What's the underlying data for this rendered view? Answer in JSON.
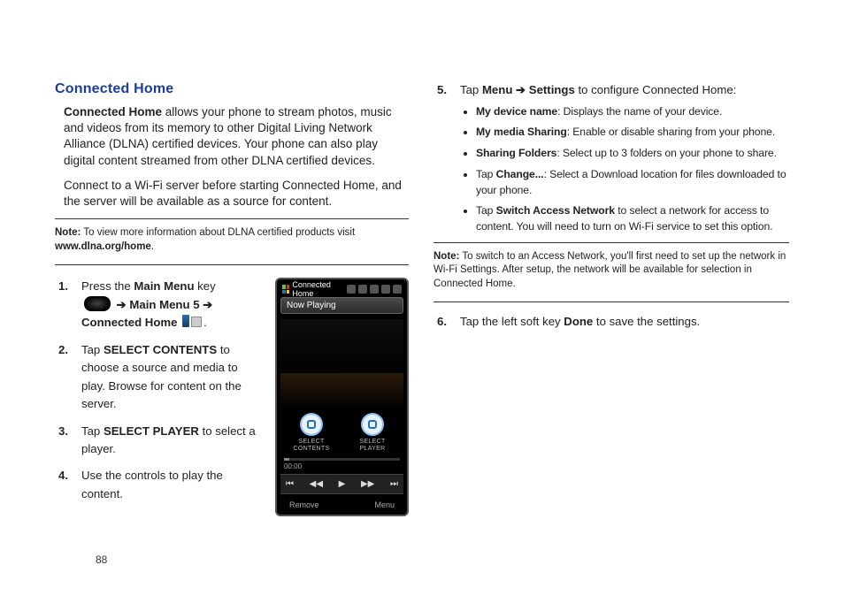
{
  "page_number": "88",
  "left": {
    "title": "Connected Home",
    "intro1_pre": "Connected Home",
    "intro1_post": " allows your phone to stream photos, music and videos from its memory to other Digital Living Network Alliance (DLNA) certified devices.  Your phone can also play digital content streamed from other DLNA certified devices.",
    "intro2": "Connect to a Wi-Fi server before starting Connected Home, and the server will be available as a source for content.",
    "note_label": "Note:",
    "note_body": " To view more information about DLNA certified products visit ",
    "note_link": "www.dlna.org/home",
    "note_end": ".",
    "step1_a": "Press the ",
    "step1_b": "Main Menu",
    "step1_c": " key",
    "step1_d": "Main Menu 5",
    "step1_e": "Connected Home",
    "step1_f": ".",
    "arrow": "➔",
    "step2_a": "Tap ",
    "step2_b": "SELECT CONTENTS",
    "step2_c": " to choose a source and media to play. Browse for content on the server.",
    "step3_a": "Tap ",
    "step3_b": "SELECT PLAYER",
    "step3_c": " to select a player.",
    "step4": "Use the controls to play the content."
  },
  "phone": {
    "title": "Connected Home",
    "now_playing": "Now Playing",
    "select_contents_l1": "SELECT",
    "select_contents_l2": "CONTENTS",
    "select_player_l1": "SELECT",
    "select_player_l2": "PLAYER",
    "time_left": "00:00",
    "time_right": "",
    "soft_left": "Remove",
    "soft_right": "Menu"
  },
  "right": {
    "step5_a": "Tap ",
    "step5_b": "Menu",
    "step5_arrow": "➔",
    "step5_c": "Settings",
    "step5_d": " to configure Connected Home:",
    "b1_a": "My device name",
    "b1_b": ": Displays the name of your device.",
    "b2_a": "My media Sharing",
    "b2_b": ": Enable or disable sharing from your phone.",
    "b3_a": "Sharing Folders",
    "b3_b": ": Select up to 3 folders on your phone to share.",
    "b4_a": "Tap ",
    "b4_b": "Change...",
    "b4_c": ": Select a Download location for files downloaded to your phone.",
    "b5_a": "Tap ",
    "b5_b": "Switch Access Network",
    "b5_c": " to select a network for access to content.  You will need to turn on Wi-Fi service to set this option.",
    "note_label": "Note:",
    "note_body": " To switch to an Access Network, you'll first need to set up the network in Wi-Fi Settings.  After setup, the network will be available for selection in Connected Home.",
    "step6_a": "Tap the left soft key ",
    "step6_b": "Done",
    "step6_c": " to save the settings."
  }
}
